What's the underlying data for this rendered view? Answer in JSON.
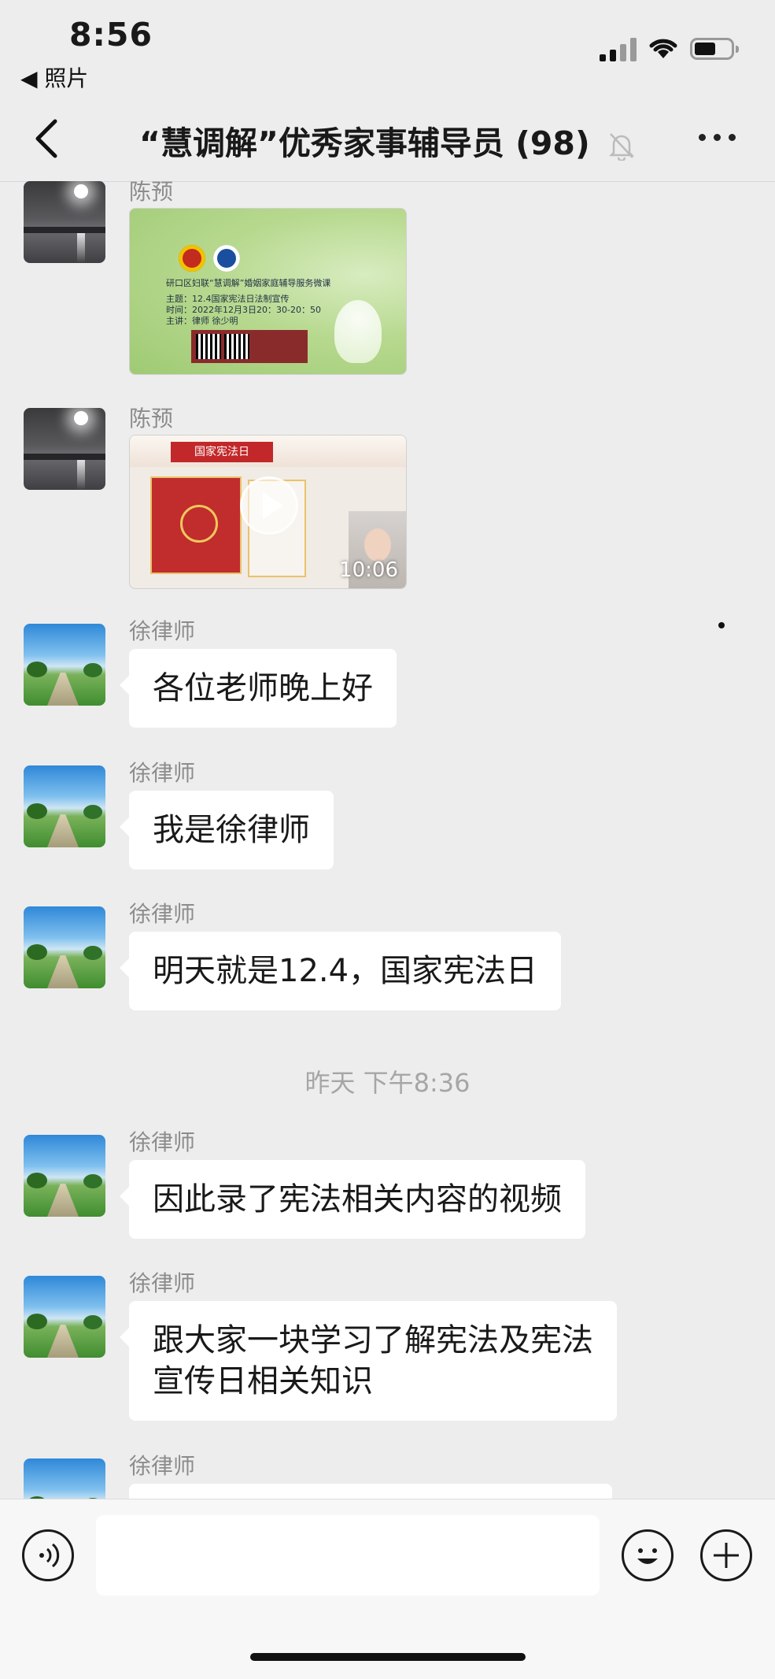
{
  "status_bar": {
    "time": "8:56",
    "back_to_app": "◀ 照片"
  },
  "nav": {
    "title": "“慧调解”优秀家事辅导员 (98)",
    "muted": true
  },
  "messages": [
    {
      "sender": "陈预",
      "type": "image",
      "avatar": "lake-sunset",
      "poster_lines": [
        "研口区妇联“慧调解”婚姻家庭辅导服务微课",
        "主题：12.4国家宪法日法制宣传",
        "时间：2022年12月3日20：30-20：50",
        "主讲：律师 徐少明"
      ]
    },
    {
      "sender": "陈预",
      "type": "video",
      "avatar": "lake-sunset",
      "video_tag": "国家宪法日",
      "duration": "10:06"
    },
    {
      "sender": "徐律师",
      "type": "text",
      "avatar": "green-field",
      "text": "各位老师晚上好"
    },
    {
      "sender": "徐律师",
      "type": "text",
      "avatar": "green-field",
      "text": "我是徐律师"
    },
    {
      "sender": "徐律师",
      "type": "text",
      "avatar": "green-field",
      "text": "明天就是12.4，国家宪法日"
    },
    {
      "timestamp": "昨天 下午8:36"
    },
    {
      "sender": "徐律师",
      "type": "text",
      "avatar": "green-field",
      "text": "因此录了宪法相关内容的视频"
    },
    {
      "sender": "徐律师",
      "type": "text",
      "avatar": "green-field",
      "text_lines": [
        "跟大家一块学习了解宪法及宪法",
        "宣传日相关知识"
      ]
    },
    {
      "sender": "徐律师",
      "type": "text",
      "avatar": "green-field",
      "text": ""
    }
  ],
  "input": {
    "value": "",
    "placeholder": ""
  }
}
